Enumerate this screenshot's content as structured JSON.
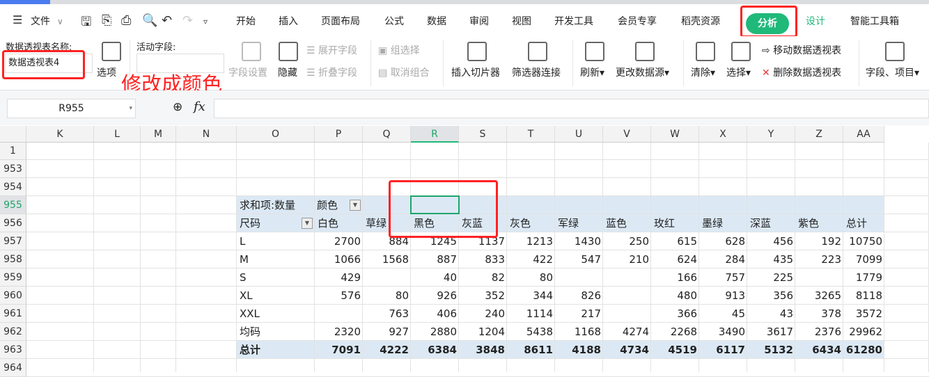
{
  "menu": {
    "file": "文件",
    "tabs": [
      "开始",
      "插入",
      "页面布局",
      "公式",
      "数据",
      "审阅",
      "视图",
      "开发工具",
      "会员专享",
      "稻壳资源"
    ],
    "active_tab": "分析",
    "design_tab": "设计",
    "toolbox_tab": "智能工具箱"
  },
  "ribbon": {
    "pivot_name_label": "数据透视表名称:",
    "pivot_name_value": "数据透视表4",
    "options": "选项",
    "active_field_label": "活动字段:",
    "field_settings": "字段设置",
    "hide": "隐藏",
    "expand_field": "展开字段",
    "collapse_field": "折叠字段",
    "group_selection": "组选择",
    "ungroup": "取消组合",
    "insert_slicer": "插入切片器",
    "filter_connections": "筛选器连接",
    "refresh": "刷新",
    "change_source": "更改数据源",
    "clear": "清除",
    "select": "选择",
    "move_pivot": "移动数据透视表",
    "delete_pivot": "删除数据透视表",
    "fields_items": "字段、项目"
  },
  "annotation": "修改成颜色",
  "formula_bar": {
    "cell_ref": "R955",
    "fx": "fx"
  },
  "columns": [
    "K",
    "L",
    "M",
    "N",
    "O",
    "P",
    "Q",
    "R",
    "S",
    "T",
    "U",
    "V",
    "W",
    "X",
    "Y",
    "Z",
    "AA"
  ],
  "rows": [
    "1",
    "953",
    "954",
    "955",
    "956",
    "957",
    "958",
    "959",
    "960",
    "961",
    "962",
    "963",
    "964"
  ],
  "pivot": {
    "title": "求和项:数量",
    "col_field": "颜色",
    "row_field": "尺码",
    "headers": [
      "白色",
      "草绿",
      "黑色",
      "灰蓝",
      "灰色",
      "军绿",
      "蓝色",
      "玫红",
      "墨绿",
      "深蓝",
      "紫色",
      "总计"
    ],
    "data": [
      {
        "label": "L",
        "values": [
          "2700",
          "884",
          "1245",
          "1137",
          "1213",
          "1430",
          "250",
          "615",
          "628",
          "456",
          "192",
          "10750"
        ]
      },
      {
        "label": "M",
        "values": [
          "1066",
          "1568",
          "887",
          "833",
          "422",
          "547",
          "210",
          "624",
          "284",
          "435",
          "223",
          "7099"
        ]
      },
      {
        "label": "S",
        "values": [
          "429",
          "",
          "40",
          "82",
          "80",
          "",
          "",
          "166",
          "757",
          "225",
          "",
          "1779"
        ]
      },
      {
        "label": "XL",
        "values": [
          "576",
          "80",
          "926",
          "352",
          "344",
          "826",
          "",
          "480",
          "913",
          "356",
          "3265",
          "8118"
        ]
      },
      {
        "label": "XXL",
        "values": [
          "",
          "763",
          "406",
          "240",
          "1114",
          "217",
          "",
          "366",
          "45",
          "43",
          "378",
          "3572"
        ]
      },
      {
        "label": "均码",
        "values": [
          "2320",
          "927",
          "2880",
          "1204",
          "5438",
          "1168",
          "4274",
          "2268",
          "3490",
          "3617",
          "2376",
          "29962"
        ]
      }
    ],
    "total": {
      "label": "总计",
      "values": [
        "7091",
        "4222",
        "6384",
        "3848",
        "8611",
        "4188",
        "4734",
        "4519",
        "6117",
        "5132",
        "6434",
        "61280"
      ]
    }
  },
  "colors": {
    "accent": "#1fb97a",
    "highlight": "#ff2222",
    "pivot_band": "#dce9f5"
  }
}
